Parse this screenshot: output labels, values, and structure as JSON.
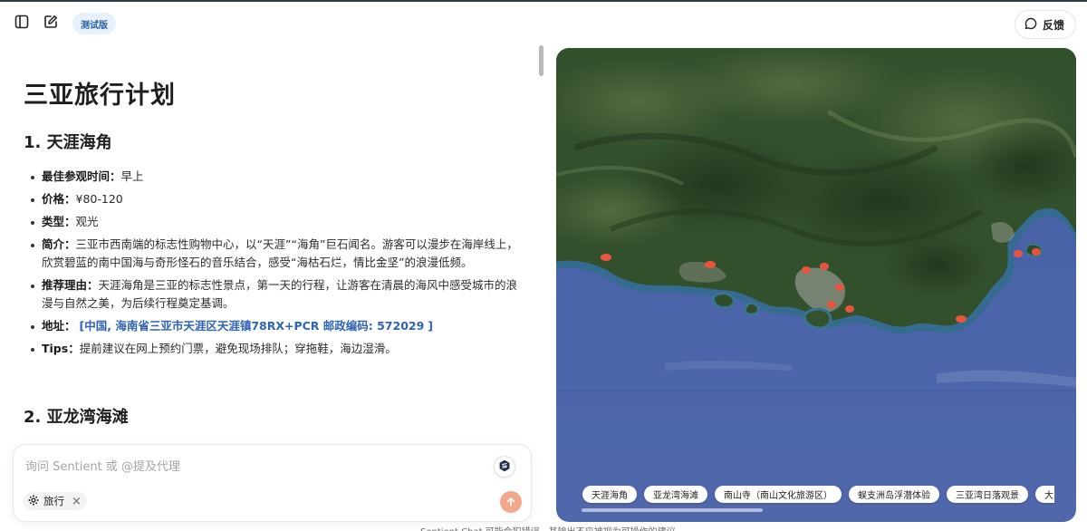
{
  "toolbar": {
    "badge": "测试版",
    "feedback": "反馈"
  },
  "doc": {
    "title": "三亚旅行计划",
    "section1": {
      "heading": "1. 天涯海角",
      "best_time_label": "最佳参观时间：",
      "best_time": "早上",
      "price_label": "价格：",
      "price": "¥80-120",
      "type_label": "类型：",
      "type": "观光",
      "intro_label": "简介：",
      "intro": "三亚市西南端的标志性购物中心，以“天涯”“海角”巨石闻名。游客可以漫步在海岸线上，欣赏碧蓝的南中国海与奇形怪石的音乐结合，感受“海枯石烂，情比金坚”的浪漫低频。",
      "reason_label": "推荐理由：",
      "reason": "天涯海角是三亚的标志性景点，第一天的行程，让游客在清晨的海风中感受城市的浪漫与自然之美，为后续行程奠定基调。",
      "address_label": "地址：",
      "address_open": "[",
      "address": "中国, 海南省三亚市天涯区天涯镇78RX+PCR 邮政编码: 572029",
      "address_close": "]",
      "tips_label": "Tips：",
      "tips": "提前建议在网上预约门票，避免现场排队；穿拖鞋，海边湿滑。"
    },
    "section2": {
      "heading": "2. 亚龙湾海滩"
    }
  },
  "composer": {
    "placeholder": "询问 Sentient 或 @提及代理",
    "chip_label": "旅行",
    "chip_close": "×"
  },
  "disclaimer": "Sentient Chat 可能会犯错误，其输出不应被视为可操作的建议。",
  "map": {
    "places": [
      "天涯海角",
      "亚龙湾海滩",
      "南山寺（南山文化旅游区）",
      "蜈支洲岛浮潜体验",
      "三亚湾日落观景",
      "大东海夜市"
    ],
    "colors": {
      "sea": "#4a62a8",
      "land": "#33502c",
      "marker": "#e8553e"
    }
  }
}
